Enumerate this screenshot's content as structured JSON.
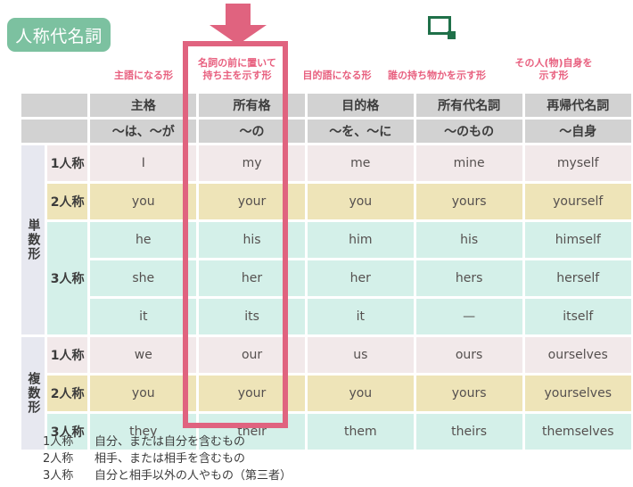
{
  "title_badge": {
    "label": "人称代名詞"
  },
  "colors": {
    "badge_green": "#7cc1a0",
    "accent_pink": "#e0637f",
    "caption_pink": "#e8607f",
    "marker_green": "#1f7049",
    "header_gray": "#d2d2d2",
    "row_first": "#f2e9ea",
    "row_second": "#eee4b8",
    "row_third": "#d4f0e9",
    "vlabel_lavender": "#e7e8f0"
  },
  "decorations": {
    "arrow": "down-arrow-icon",
    "square_marker": "green-square-icon"
  },
  "captions": [
    {
      "text": "主語になる形",
      "lines": [
        "主語になる形"
      ]
    },
    {
      "text": "名詞の前に置いて 持ち主を示す形",
      "lines": [
        "名詞の前に置いて",
        "持ち主を示す形"
      ]
    },
    {
      "text": "目的語になる形",
      "lines": [
        "目的語になる形"
      ]
    },
    {
      "text": "誰の持ち物かを示す形",
      "lines": [
        "誰の持ち物かを示す形"
      ]
    },
    {
      "text": "その人(物)自身を 示す形",
      "lines": [
        "その人(物)自身を",
        "示す形"
      ]
    }
  ],
  "table": {
    "header_case": [
      "主格",
      "所有格",
      "目的格",
      "所有代名詞",
      "再帰代名詞"
    ],
    "header_particle": [
      "〜は、〜が",
      "〜の",
      "〜を、〜に",
      "〜のもの",
      "〜自身"
    ],
    "number_groups": [
      {
        "label": "単数形",
        "rows": [
          0,
          1,
          2,
          3,
          4
        ]
      },
      {
        "label": "複数形",
        "rows": [
          5,
          6,
          7
        ]
      }
    ],
    "rows": [
      {
        "person": "1人称",
        "person_rowspan": 1,
        "tone": "first",
        "cells": [
          "I",
          "my",
          "me",
          "mine",
          "myself"
        ]
      },
      {
        "person": "2人称",
        "person_rowspan": 1,
        "tone": "second",
        "cells": [
          "you",
          "your",
          "you",
          "yours",
          "yourself"
        ]
      },
      {
        "person": "3人称",
        "person_rowspan": 3,
        "tone": "third",
        "cells": [
          "he",
          "his",
          "him",
          "his",
          "himself"
        ]
      },
      {
        "person": "",
        "person_rowspan": 0,
        "tone": "third",
        "cells": [
          "she",
          "her",
          "her",
          "hers",
          "herself"
        ]
      },
      {
        "person": "",
        "person_rowspan": 0,
        "tone": "third",
        "cells": [
          "it",
          "its",
          "it",
          "—",
          "itself"
        ]
      },
      {
        "person": "1人称",
        "person_rowspan": 1,
        "tone": "first",
        "cells": [
          "we",
          "our",
          "us",
          "ours",
          "ourselves"
        ]
      },
      {
        "person": "2人称",
        "person_rowspan": 1,
        "tone": "second",
        "cells": [
          "you",
          "your",
          "you",
          "yours",
          "yourselves"
        ]
      },
      {
        "person": "3人称",
        "person_rowspan": 1,
        "tone": "third",
        "cells": [
          "they",
          "their",
          "them",
          "theirs",
          "themselves"
        ]
      }
    ]
  },
  "highlight": {
    "column": "所有格",
    "note": "possessive-determiner-column-highlight"
  },
  "footnotes": [
    {
      "key": "1人称",
      "text": "自分、または自分を含むもの"
    },
    {
      "key": "2人称",
      "text": "相手、または相手を含むもの"
    },
    {
      "key": "3人称",
      "text": "自分と相手以外の人やもの（第三者）"
    }
  ]
}
